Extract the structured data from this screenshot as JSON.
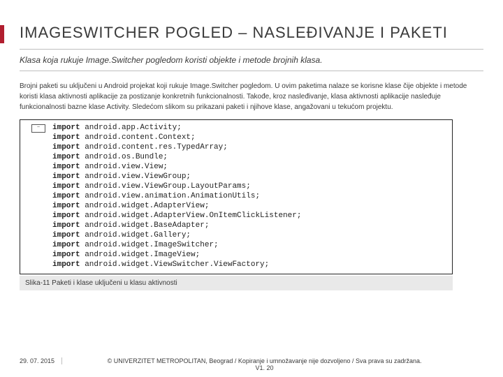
{
  "accent_color": "#b11e2f",
  "title": "IMAGESWITCHER POGLED – NASLEĐIVANJE I PAKETI",
  "subtitle": "Klasa koja rukuje Image.Switcher pogledom koristi objekte i metode brojnih klasa.",
  "body": "Brojni paketi su uključeni u Android projekat koji rukuje Image.Switcher pogledom. U ovim paketima nalaze se korisne klase čije objekte i metode koristi klasa aktivnosti aplikacije za postizanje konkretnih funkcionalnosti. Takođe, kroz nasleđivanje, klasa aktivnosti aplikacije nasleđuje funkcionalnosti bazne klase Activity. Sledećom slikom su prikazani paketi i njihove klase, angažovani u tekućom projektu.",
  "collapse_marker": "−",
  "imports": [
    "android.app.Activity;",
    "android.content.Context;",
    "android.content.res.TypedArray;",
    "android.os.Bundle;",
    "android.view.View;",
    "android.view.ViewGroup;",
    "android.view.ViewGroup.LayoutParams;",
    "android.view.animation.AnimationUtils;",
    "android.widget.AdapterView;",
    "android.widget.AdapterView.OnItemClickListener;",
    "android.widget.BaseAdapter;",
    "android.widget.Gallery;",
    "android.widget.ImageSwitcher;",
    "android.widget.ImageView;",
    "android.widget.ViewSwitcher.ViewFactory;"
  ],
  "import_keyword": "import",
  "caption": "Slika-11 Paketi i klase uključeni u klasu aktivnosti",
  "footer": {
    "date": "29. 07. 2015",
    "copyright": "© UNIVERZITET METROPOLITAN, Beograd / Kopiranje i umnožavanje nije dozvoljeno / Sva prava su zadržana.",
    "version": "V1. 20"
  }
}
